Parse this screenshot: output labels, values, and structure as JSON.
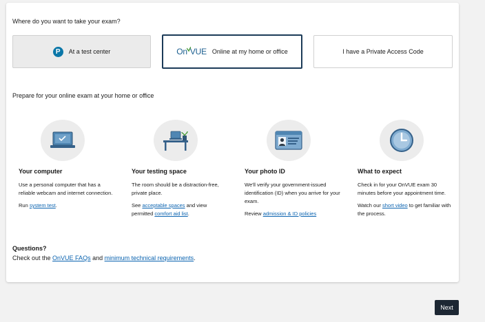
{
  "question": "Where do you want to take your exam?",
  "options": [
    {
      "label": "At a test center",
      "logo": "P"
    },
    {
      "label": "Online at my home or office",
      "logo_on": "On",
      "logo_vue": "VUE"
    },
    {
      "label": "I have a Private Access Code"
    }
  ],
  "prepare_heading": "Prepare for your online exam at your home or office",
  "columns": [
    {
      "icon": "laptop-icon",
      "title": "Your computer",
      "text": "Use a personal computer that has a reliable webcam and internet connection.",
      "p2_pre": "Run ",
      "p2_link": "system test",
      "p2_post": "."
    },
    {
      "icon": "desk-icon",
      "title": "Your testing space",
      "text": "The room should be a distraction-free, private place.",
      "p2_pre": "See ",
      "p2_link": "acceptable spaces",
      "p2_mid": " and view permitted ",
      "p2_link2": "comfort aid list",
      "p2_post": "."
    },
    {
      "icon": "id-card-icon",
      "title": "Your photo ID",
      "text": "We'll verify your government-issued identification (ID) when you arrive for your exam.",
      "p2_pre": "Review ",
      "p2_link": "admission & ID policies",
      "p2_post": ""
    },
    {
      "icon": "clock-icon",
      "title": "What to expect",
      "text": "Check in for your OnVUE exam 30 minutes before your appointment time.",
      "p2_pre": "Watch our ",
      "p2_link": "short video",
      "p2_post": " to get familiar with the process."
    }
  ],
  "questions": {
    "heading": "Questions?",
    "pre": "Check out the ",
    "link1": "OnVUE FAQs",
    "mid": " and ",
    "link2": "minimum technical requirements",
    "post": "."
  },
  "next_label": "Next",
  "colors": {
    "accent": "#1b3a57",
    "link": "#0a63b0",
    "icon_blue": "#5a8fb8"
  }
}
